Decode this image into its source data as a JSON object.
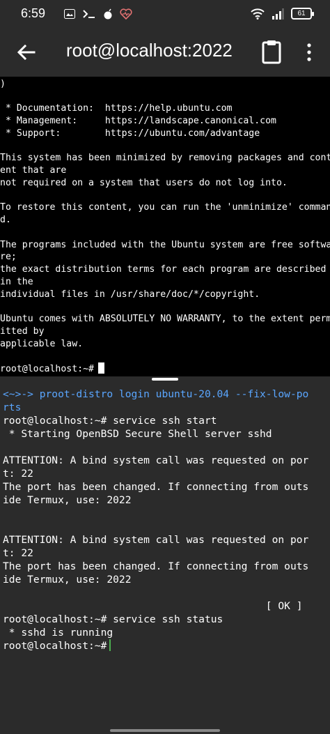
{
  "status_bar": {
    "time": "6:59",
    "battery": "61"
  },
  "app_bar": {
    "title": "root@localhost:2022"
  },
  "top_terminal": {
    "lines": [
      ")",
      "",
      " * Documentation:  https://help.ubuntu.com",
      " * Management:     https://landscape.canonical.com",
      " * Support:        https://ubuntu.com/advantage",
      "",
      "This system has been minimized by removing packages and cont",
      "ent that are",
      "not required on a system that users do not log into.",
      "",
      "To restore this content, you can run the 'unminimize' comman",
      "d.",
      "",
      "The programs included with the Ubuntu system are free softwa",
      "re;",
      "the exact distribution terms for each program are described",
      "in the",
      "individual files in /usr/share/doc/*/copyright.",
      "",
      "Ubuntu comes with ABSOLUTELY NO WARRANTY, to the extent perm",
      "itted by",
      "applicable law.",
      "",
      "root@localhost:~#"
    ]
  },
  "bottom_terminal": {
    "lines": [
      "<~>-> proot-distro login ubuntu-20.04 --fix-low-po",
      "rts",
      "root@localhost:~# service ssh start",
      " * Starting OpenBSD Secure Shell server sshd",
      "",
      "ATTENTION: A bind system call was requested on por",
      "t: 22",
      "The port has been changed. If connecting from outs",
      "ide Termux, use: 2022",
      "",
      "",
      "ATTENTION: A bind system call was requested on por",
      "t: 22",
      "The port has been changed. If connecting from outs",
      "ide Termux, use: 2022",
      "",
      "                                           [ OK ]",
      "root@localhost:~# service ssh status",
      " * sshd is running",
      "root@localhost:~#"
    ]
  },
  "colors": {
    "command_blue": "#5aa6ff",
    "cursor_green": "#4caf50"
  }
}
